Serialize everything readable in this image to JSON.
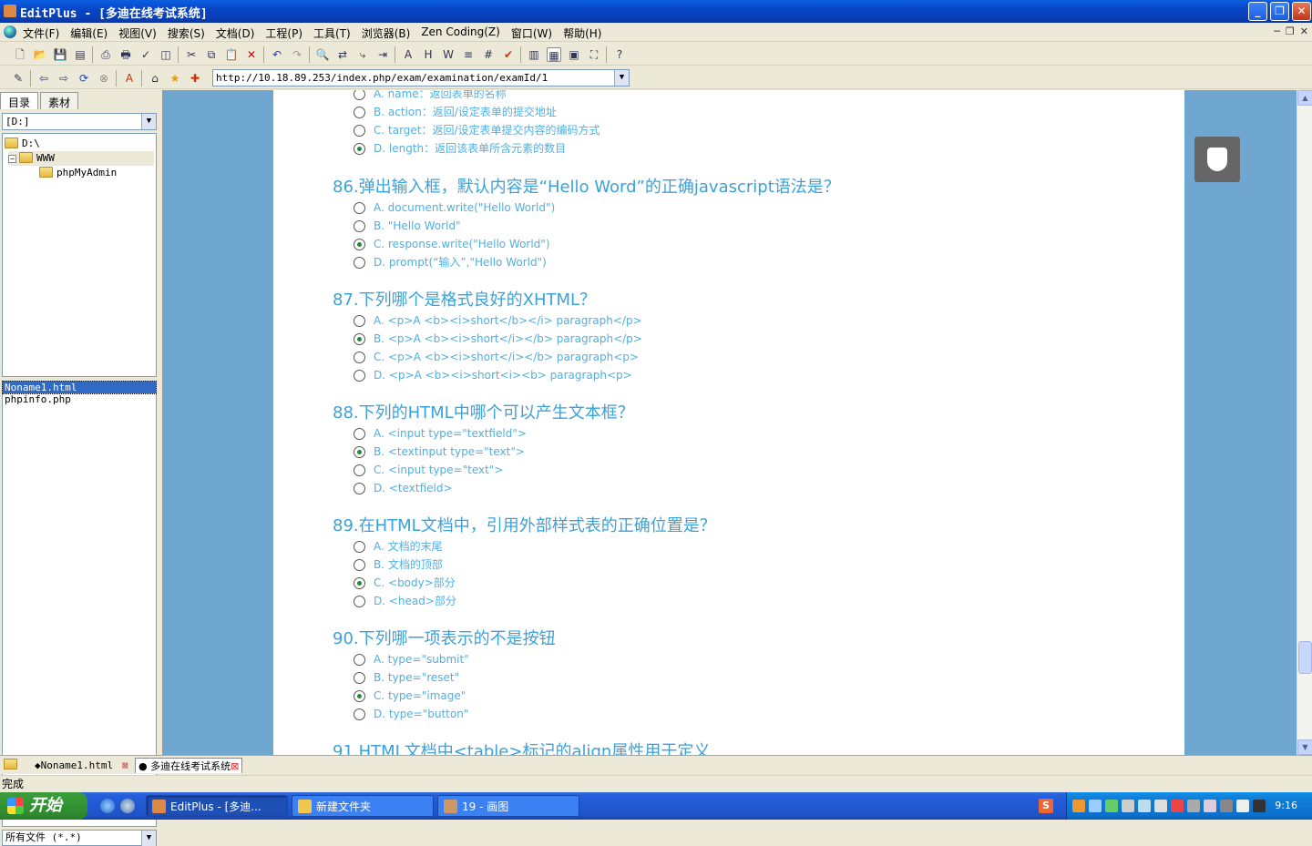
{
  "window": {
    "title": "EditPlus - [多迪在线考试系统]"
  },
  "menu": [
    "文件(F)",
    "编辑(E)",
    "视图(V)",
    "搜索(S)",
    "文档(D)",
    "工程(P)",
    "工具(T)",
    "浏览器(B)",
    "Zen Coding(Z)",
    "窗口(W)",
    "帮助(H)"
  ],
  "address": {
    "url": "http://10.18.89.253/index.php/exam/examination/examId/1"
  },
  "sidebar": {
    "tabs": [
      "目录",
      "素材"
    ],
    "drive": "[D:]",
    "tree": [
      {
        "label": "D:\\"
      },
      {
        "label": "WWW"
      },
      {
        "label": "phpMyAdmin"
      }
    ],
    "files": [
      "Noname1.html",
      "phpinfo.php"
    ],
    "filter": "所有文件 (*.*)"
  },
  "questions": [
    {
      "title": "",
      "options": [
        "A.  name：返回表单的名称",
        "B.  action：返回/设定表单的提交地址",
        "C.  target：返回/设定表单提交内容的编码方式",
        "D.  length：返回该表单所含元素的数目"
      ],
      "selected": 3
    },
    {
      "title": "86.弹出输入框，默认内容是“Hello Word”的正确javascript语法是？",
      "options": [
        "A. document.write(\"Hello World\")",
        "B.  \"Hello World\"",
        "C.  response.write(\"Hello World\")",
        "D.  prompt(“输入”,\"Hello World\")"
      ],
      "selected": 2
    },
    {
      "title": "87.下列哪个是格式良好的XHTML？",
      "options": [
        "A. <p>A <b><i>short</b></i> paragraph</p>",
        "B. <p>A <b><i>short</i></b> paragraph</p>",
        "C. <p>A <b><i>short</i></b> paragraph<p>",
        "D. <p>A <b><i>short<i><b> paragraph<p>"
      ],
      "selected": 1
    },
    {
      "title": "88.下列的HTML中哪个可以产生文本框？",
      "options": [
        "A. <input type=\"textfield\">",
        "B. <textinput type=\"text\">",
        "C.  <input type=\"text\">",
        "D.  <textfield>"
      ],
      "selected": 1
    },
    {
      "title": "89.在HTML文档中，引用外部样式表的正确位置是？",
      "options": [
        "A. 文档的末尾",
        "B. 文档的顶部",
        "C. <body>部分",
        "D. <head>部分"
      ],
      "selected": 2
    },
    {
      "title": "90.下列哪一项表示的不是按钮",
      "options": [
        "A. type=\"submit\"",
        "B. type=\"reset\"",
        "C. type=\"image\"",
        "D. type=\"button\""
      ],
      "selected": 2
    },
    {
      "title": "91.HTML文档中<table>标记的align属性用于定义",
      "options": [],
      "selected": -1
    }
  ],
  "doctabs": [
    "Noname1.html",
    "多迪在线考试系统"
  ],
  "status": "完成",
  "taskbar": {
    "start": "开始",
    "tasks": [
      "EditPlus - [多迪...",
      "新建文件夹",
      "19 - 画图"
    ],
    "clock": "9:16",
    "ime": "S"
  },
  "colors": {
    "accent": "#3ba1d9",
    "page_bg": "#6fa7d0",
    "selected_radio": "#1d8a3a"
  }
}
